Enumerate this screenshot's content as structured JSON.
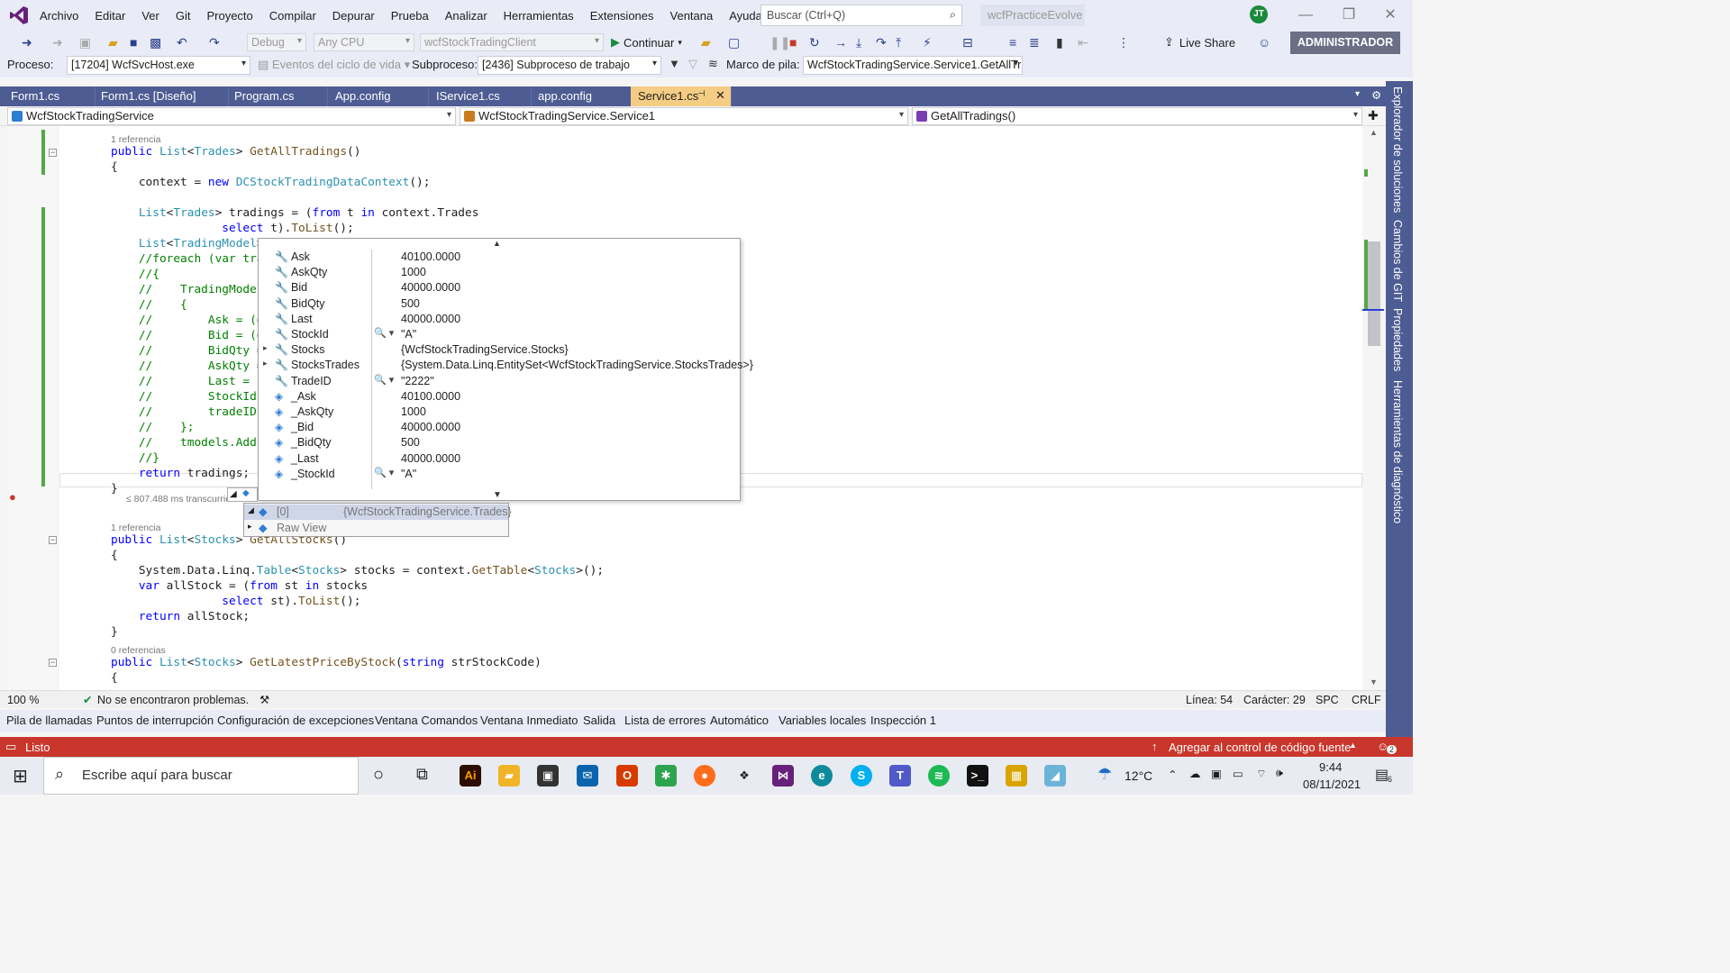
{
  "menu": [
    "Archivo",
    "Editar",
    "Ver",
    "Git",
    "Proyecto",
    "Compilar",
    "Depurar",
    "Prueba",
    "Analizar",
    "Herramientas",
    "Extensiones",
    "Ventana",
    "Ayuda"
  ],
  "search_placeholder": "Buscar (Ctrl+Q)",
  "solution_name": "wcfPracticeEvolve",
  "user_initials": "JT",
  "toolbar": {
    "config": "Debug",
    "platform": "Any CPU",
    "startup": "wcfStockTradingClient",
    "continue": "Continuar",
    "live_share": "Live Share",
    "admin": "ADMINISTRADOR"
  },
  "debugbar": {
    "process_label": "Proceso:",
    "process": "[17204] WcfSvcHost.exe",
    "lifecycle": "Eventos del ciclo de vida",
    "thread_label": "Subproceso:",
    "thread": "[2436] Subproceso de trabajo",
    "frame_label": "Marco de pila:",
    "frame": "WcfStockTradingService.Service1.GetAllTra"
  },
  "tabs": [
    "Form1.cs",
    "Form1.cs [Diseño]",
    "Program.cs",
    "App.config",
    "IService1.cs",
    "app.config",
    "Service1.cs"
  ],
  "nav": {
    "project": "WcfStockTradingService",
    "class": "WcfStockTradingService.Service1",
    "member": "GetAllTradings()"
  },
  "right_tabs": [
    "Explorador de soluciones",
    "Cambios de GIT",
    "Propiedades",
    "Herramientas de diagnóstico"
  ],
  "code": {
    "ref1": "1 referencia",
    "elapsed": "≤ 807.488 ms transcurrido",
    "ref2": "1 referencia",
    "ref3": "0 referencias"
  },
  "datatip": {
    "rows": [
      {
        "name": "Ask",
        "value": "40100.0000",
        "kind": "prop"
      },
      {
        "name": "AskQty",
        "value": "1000",
        "kind": "prop"
      },
      {
        "name": "Bid",
        "value": "40000.0000",
        "kind": "prop"
      },
      {
        "name": "BidQty",
        "value": "500",
        "kind": "prop"
      },
      {
        "name": "Last",
        "value": "40000.0000",
        "kind": "prop"
      },
      {
        "name": "StockId",
        "value": "\"A\"",
        "kind": "prop",
        "mag": true
      },
      {
        "name": "Stocks",
        "value": "{WcfStockTradingService.Stocks}",
        "kind": "prop",
        "expand": true
      },
      {
        "name": "StocksTrades",
        "value": "{System.Data.Linq.EntitySet<WcfStockTradingService.StocksTrades>}",
        "kind": "prop",
        "expand": true
      },
      {
        "name": "TradeID",
        "value": "\"2222\"",
        "kind": "prop",
        "mag": true
      },
      {
        "name": "_Ask",
        "value": "40100.0000",
        "kind": "field"
      },
      {
        "name": "_AskQty",
        "value": "1000",
        "kind": "field"
      },
      {
        "name": "_Bid",
        "value": "40000.0000",
        "kind": "field"
      },
      {
        "name": "_BidQty",
        "value": "500",
        "kind": "field"
      },
      {
        "name": "_Last",
        "value": "40000.0000",
        "kind": "field"
      },
      {
        "name": "_StockId",
        "value": "\"A\"",
        "kind": "field",
        "mag": true
      }
    ],
    "sub": [
      {
        "name": "[0]",
        "value": "{WcfStockTradingService.Trades}"
      },
      {
        "name": "Raw View",
        "value": ""
      }
    ]
  },
  "editor_status": {
    "zoom": "100 %",
    "problems": "No se encontraron problemas.",
    "line": "Línea: 54",
    "char": "Carácter: 29",
    "spc": "SPC",
    "crlf": "CRLF"
  },
  "tool_windows": [
    "Pila de llamadas",
    "Puntos de interrupción",
    "Configuración de excepciones",
    "Ventana Comandos",
    "Ventana Inmediato",
    "Salida",
    "Lista de errores",
    "Automático",
    "Variables locales",
    "Inspección 1"
  ],
  "status": {
    "ready": "Listo",
    "source_control": "Agregar al control de código fuente",
    "notif": "2"
  },
  "taskbar": {
    "search": "Escribe aquí para buscar",
    "temp": "12°C",
    "time": "9:44",
    "date": "08/11/2021",
    "notif": "6"
  },
  "colors": {
    "accent": "#4d5c92",
    "status": "#c9372c",
    "active_tab": "#f5cc84"
  }
}
